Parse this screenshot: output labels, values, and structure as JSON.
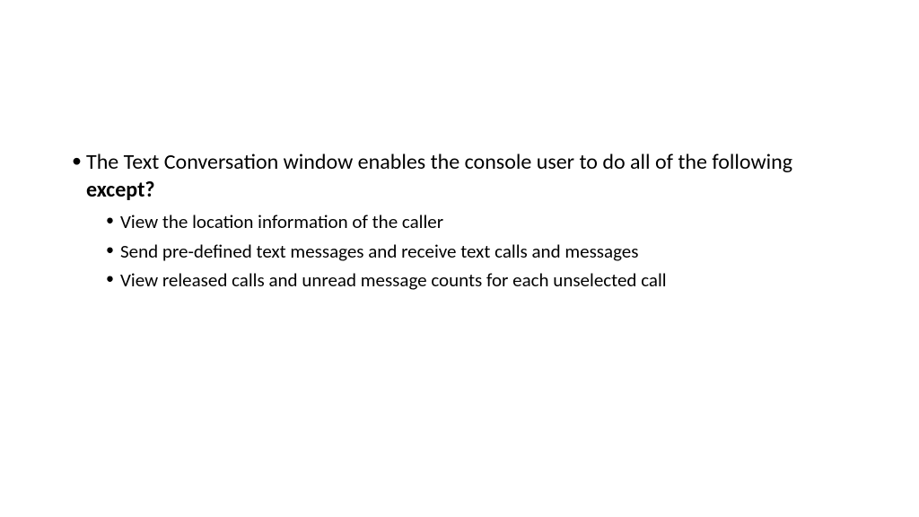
{
  "question": {
    "text_prefix": "The Text Conversation window enables the console user to do all of the following ",
    "text_bold": "except?"
  },
  "options": [
    "View the location information of the caller",
    "Send pre-defined text messages and receive text calls and messages",
    "View released calls and unread message counts for each unselected call"
  ]
}
